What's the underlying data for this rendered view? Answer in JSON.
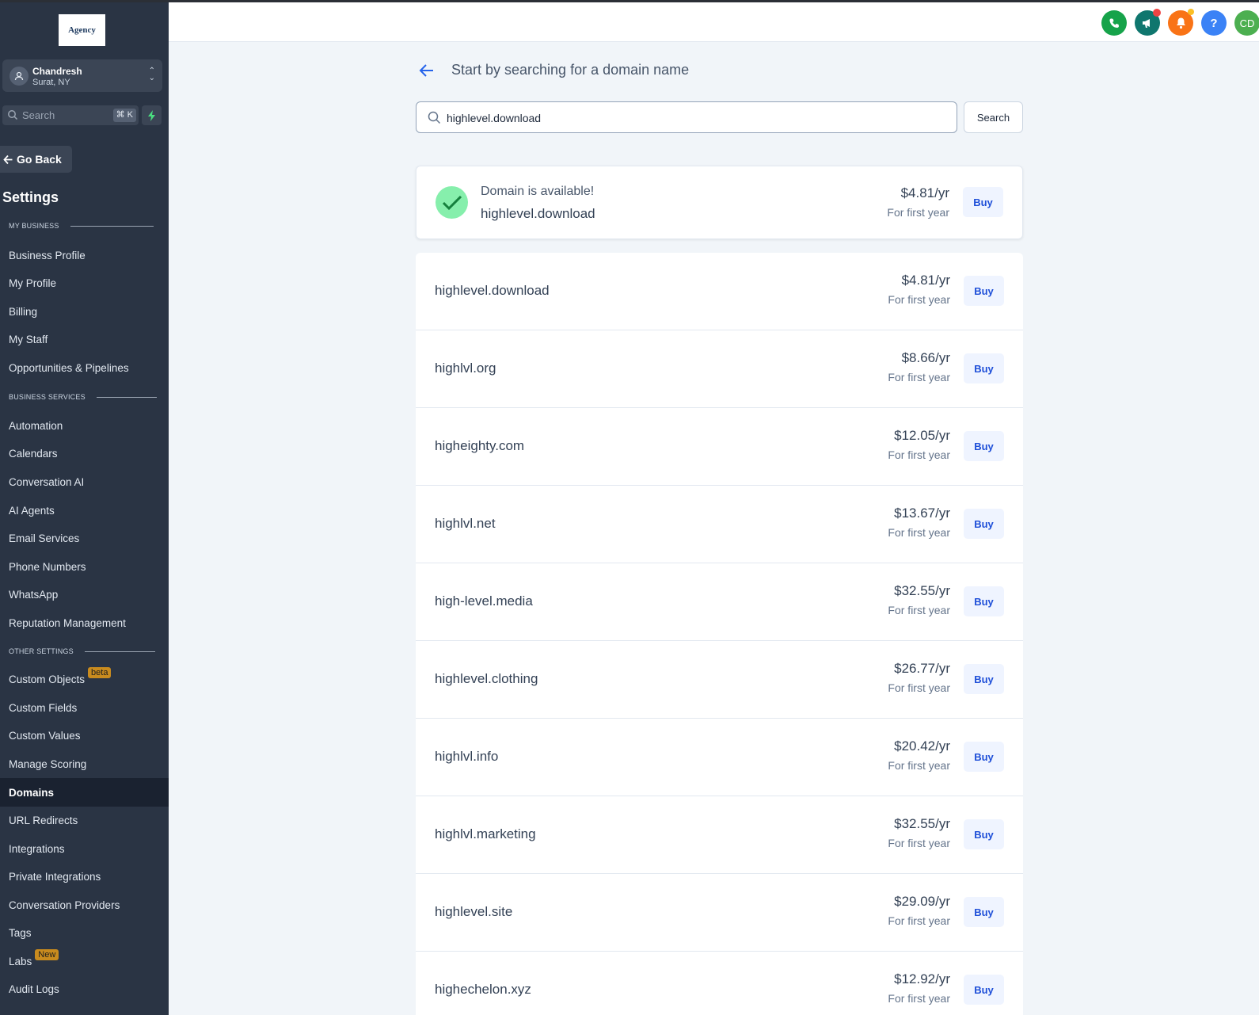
{
  "sidebar": {
    "logo_text": "Agency",
    "account": {
      "name": "Chandresh",
      "location": "Surat, NY"
    },
    "search": {
      "placeholder": "Search",
      "shortcut": "⌘ K"
    },
    "go_back": "Go Back",
    "title": "Settings",
    "sections": {
      "my_business": "MY BUSINESS",
      "business_services": "BUSINESS SERVICES",
      "other_settings": "OTHER SETTINGS"
    },
    "items": [
      {
        "label": "Business Profile"
      },
      {
        "label": "My Profile"
      },
      {
        "label": "Billing"
      },
      {
        "label": "My Staff"
      },
      {
        "label": "Opportunities & Pipelines"
      },
      {
        "label": "Automation"
      },
      {
        "label": "Calendars"
      },
      {
        "label": "Conversation AI"
      },
      {
        "label": "AI Agents"
      },
      {
        "label": "Email Services"
      },
      {
        "label": "Phone Numbers"
      },
      {
        "label": "WhatsApp"
      },
      {
        "label": "Reputation Management"
      },
      {
        "label": "Custom Objects",
        "badge": "beta"
      },
      {
        "label": "Custom Fields"
      },
      {
        "label": "Custom Values"
      },
      {
        "label": "Manage Scoring"
      },
      {
        "label": "Domains",
        "active": true
      },
      {
        "label": "URL Redirects"
      },
      {
        "label": "Integrations"
      },
      {
        "label": "Private Integrations"
      },
      {
        "label": "Conversation Providers"
      },
      {
        "label": "Tags"
      },
      {
        "label": "Labs",
        "badge": "New"
      },
      {
        "label": "Audit Logs"
      }
    ]
  },
  "header": {
    "avatar_initials": "CD",
    "help_label": "?"
  },
  "main": {
    "title": "Start by searching for a domain name",
    "search_value": "highlevel.download",
    "search_button": "Search",
    "availability": {
      "status": "Domain is available!",
      "domain": "highlevel.download",
      "price": "$4.81/yr",
      "price_note": "For first year",
      "buy_label": "Buy"
    },
    "results": [
      {
        "domain": "highlevel.download",
        "price": "$4.81/yr",
        "note": "For first year",
        "buy": "Buy"
      },
      {
        "domain": "highlvl.org",
        "price": "$8.66/yr",
        "note": "For first year",
        "buy": "Buy"
      },
      {
        "domain": "higheighty.com",
        "price": "$12.05/yr",
        "note": "For first year",
        "buy": "Buy"
      },
      {
        "domain": "highlvl.net",
        "price": "$13.67/yr",
        "note": "For first year",
        "buy": "Buy"
      },
      {
        "domain": "high-level.media",
        "price": "$32.55/yr",
        "note": "For first year",
        "buy": "Buy"
      },
      {
        "domain": "highlevel.clothing",
        "price": "$26.77/yr",
        "note": "For first year",
        "buy": "Buy"
      },
      {
        "domain": "highlvl.info",
        "price": "$20.42/yr",
        "note": "For first year",
        "buy": "Buy"
      },
      {
        "domain": "highlvl.marketing",
        "price": "$32.55/yr",
        "note": "For first year",
        "buy": "Buy"
      },
      {
        "domain": "highlevel.site",
        "price": "$29.09/yr",
        "note": "For first year",
        "buy": "Buy"
      },
      {
        "domain": "highechelon.xyz",
        "price": "$12.92/yr",
        "note": "For first year",
        "buy": "Buy"
      }
    ]
  },
  "colors": {
    "sidebar_bg": "#2a3444",
    "accent": "#1d4ed8",
    "success": "#86efac",
    "phone": "#16a34a",
    "megaphone": "#0f766e",
    "bell": "#f97316",
    "help": "#3b82f6",
    "avatar": "#4caf50"
  }
}
